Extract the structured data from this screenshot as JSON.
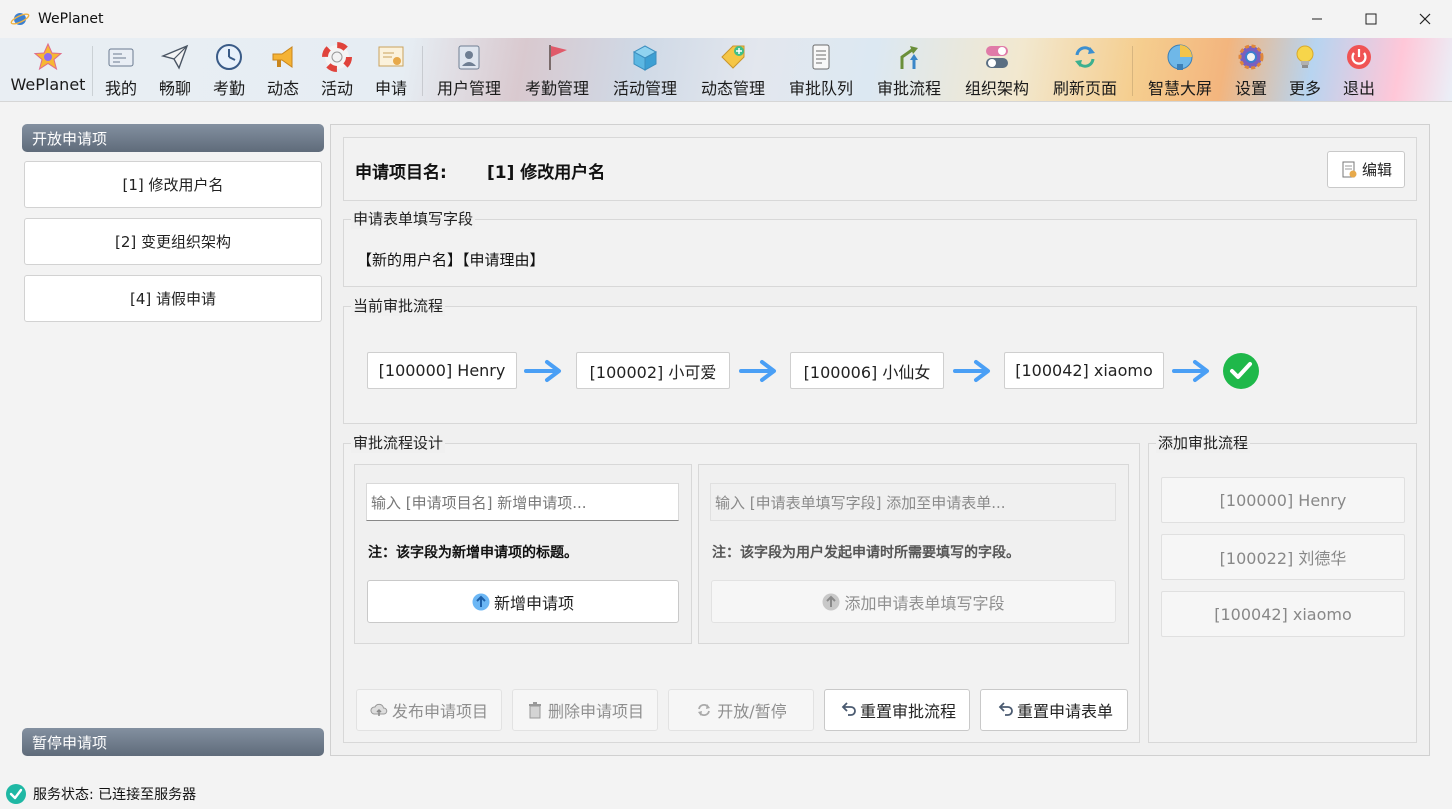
{
  "window": {
    "title": "WePlanet",
    "controls": [
      "minimize",
      "maximize",
      "close"
    ]
  },
  "toolbar": {
    "items": [
      {
        "label": "WePlanet",
        "icon": "star-icon"
      },
      {
        "label": "我的",
        "icon": "id-card-icon"
      },
      {
        "label": "畅聊",
        "icon": "paper-plane-icon"
      },
      {
        "label": "考勤",
        "icon": "clock-icon"
      },
      {
        "label": "动态",
        "icon": "megaphone-icon"
      },
      {
        "label": "活动",
        "icon": "lifebuoy-icon"
      },
      {
        "label": "申请",
        "icon": "certificate-icon"
      },
      {
        "label": "用户管理",
        "icon": "user-manage-icon"
      },
      {
        "label": "考勤管理",
        "icon": "flag-icon"
      },
      {
        "label": "活动管理",
        "icon": "cube-icon"
      },
      {
        "label": "动态管理",
        "icon": "tag-icon"
      },
      {
        "label": "审批队列",
        "icon": "scroll-icon"
      },
      {
        "label": "审批流程",
        "icon": "flow-arrows-icon"
      },
      {
        "label": "组织架构",
        "icon": "toggles-icon"
      },
      {
        "label": "刷新页面",
        "icon": "refresh-icon"
      },
      {
        "label": "智慧大屏",
        "icon": "pie-chart-icon"
      },
      {
        "label": "设置",
        "icon": "gear-icon"
      },
      {
        "label": "更多",
        "icon": "lightbulb-icon"
      },
      {
        "label": "退出",
        "icon": "power-icon"
      }
    ]
  },
  "left": {
    "open_header": "开放申请项",
    "open_items": [
      "[1] 修改用户名",
      "[2] 变更组织架构",
      "[4] 请假申请"
    ],
    "paused_header": "暂停申请项"
  },
  "main": {
    "item_label": "申请项目名:",
    "item_name": "[1] 修改用户名",
    "edit_button": "编辑",
    "fields_title": "申请表单填写字段",
    "fields_value": "【新的用户名】【申请理由】",
    "flow_title": "当前审批流程",
    "flow_nodes": [
      "[100000] Henry",
      "[100002] 小可爱",
      "[100006] 小仙女",
      "[100042] xiaomo"
    ],
    "design_title": "审批流程设计",
    "new_item_placeholder": "输入 [申请项目名] 新增申请项...",
    "new_item_note": "注：该字段为新增申请项的标题。",
    "new_item_button": "新增申请项",
    "add_field_placeholder": "输入 [申请表单填写字段] 添加至申请表单...",
    "add_field_note": "注：该字段为用户发起申请时所需要填写的字段。",
    "add_field_button": "添加申请表单填写字段",
    "actions": {
      "publish": "发布申请项目",
      "delete": "删除申请项目",
      "toggle": "开放/暂停",
      "reset_flow": "重置审批流程",
      "reset_form": "重置申请表单"
    },
    "add_flow_title": "添加审批流程",
    "approvers": [
      "[100000] Henry",
      "[100022] 刘德华",
      "[100042] xiaomo"
    ]
  },
  "status": {
    "text": "服务状态: 已连接至服务器"
  },
  "colors": {
    "arrow": "#4a9ff5",
    "check": "#1fb84a",
    "section_header": "#6b7786"
  }
}
